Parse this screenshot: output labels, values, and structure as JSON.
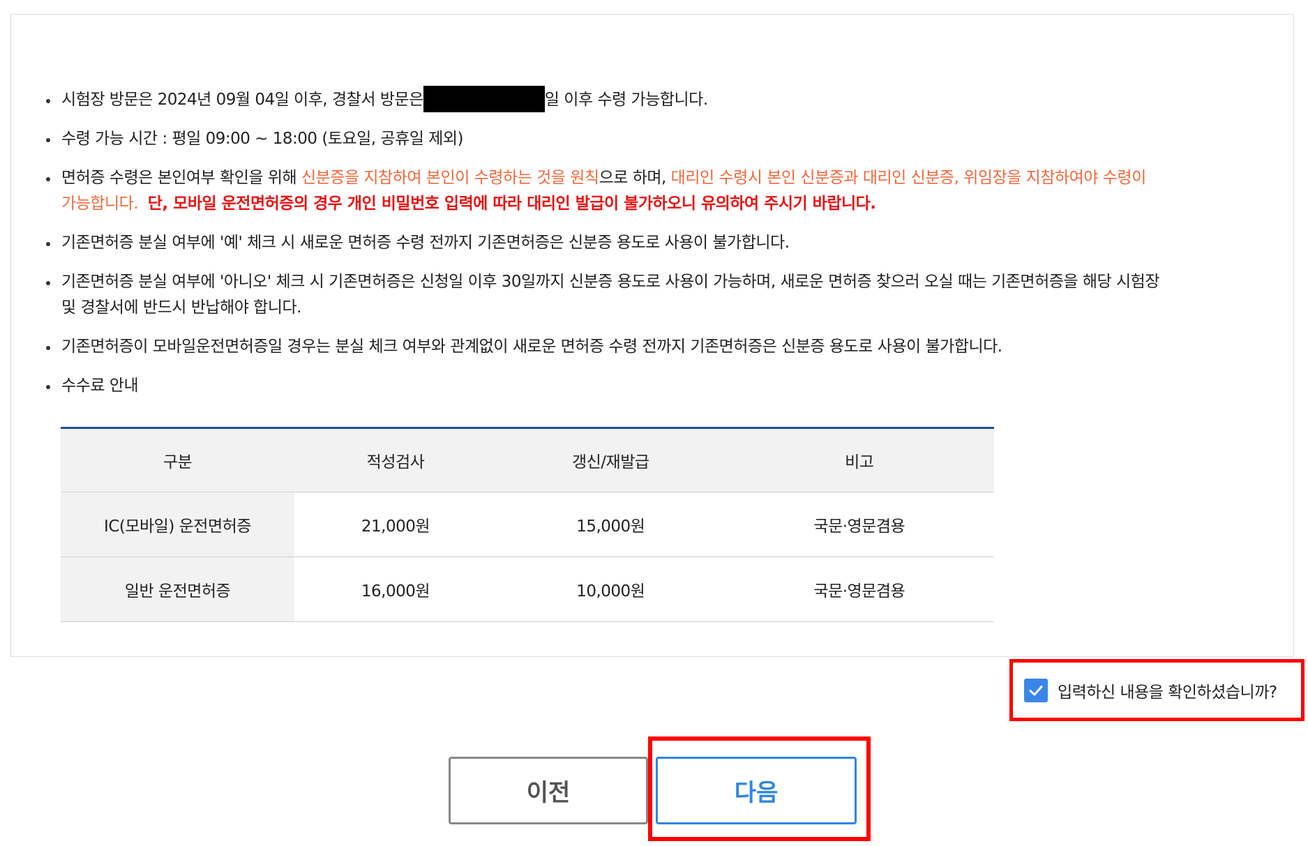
{
  "notices": {
    "item1_before": "시험장 방문은 2024년 09월 04일 이후, 경찰서 방문은",
    "item1_after": "일 이후 수령 가능합니다.",
    "item2": "수령 가능 시간 : 평일 09:00 ~ 18:00 (토요일, 공휴일 제외)",
    "item3_a": "면허증 수령은 본인여부 확인을 위해 ",
    "item3_b": "신분증을 지참하여 본인이 수령하는 것을 원칙",
    "item3_c": "으로 하며, ",
    "item3_d": "대리인 수령시 본인 신분증과 대리인 신분증, 위임장을 지참하여야 수령이",
    "item3_e": "가능합니다.",
    "item3_f": "단, 모바일 운전면허증의 경우 개인 비밀번호 입력에 따라 대리인 발급이 불가하오니 유의하여 주시기 바랍니다.",
    "item4": "기존면허증 분실 여부에 '예' 체크 시 새로운 면허증 수령 전까지 기존면허증은 신분증 용도로 사용이 불가합니다.",
    "item5_line1": "기존면허증 분실 여부에 '아니오' 체크 시 기존면허증은 신청일 이후 30일까지 신분증 용도로 사용이 가능하며, 새로운 면허증 찾으러 오실 때는 기존면허증을 해당 시험장",
    "item5_line2": "및 경찰서에 반드시 반납해야 합니다.",
    "item6": "기존면허증이 모바일운전면허증일 경우는 분실 체크 여부와 관계없이 새로운 면허증 수령 전까지 기존면허증은 신분증 용도로 사용이 불가합니다.",
    "item7": "수수료 안내"
  },
  "fee_table": {
    "headers": [
      "구분",
      "적성검사",
      "갱신/재발급",
      "비고"
    ],
    "rows": [
      [
        "IC(모바일) 운전면허증",
        "21,000원",
        "15,000원",
        "국문·영문겸용"
      ],
      [
        "일반 운전면허증",
        "16,000원",
        "10,000원",
        "국문·영문겸용"
      ]
    ]
  },
  "confirm": {
    "label": "입력하신 내용을 확인하셨습니까?",
    "checked": true
  },
  "buttons": {
    "prev_label": "이전",
    "next_label": "다음"
  },
  "colors": {
    "orange": "#f2683a",
    "red": "#ee1111",
    "table_top_border": "#1f4fa3",
    "accent_blue": "#2f86e6",
    "highlight_red": "#ff0000"
  }
}
